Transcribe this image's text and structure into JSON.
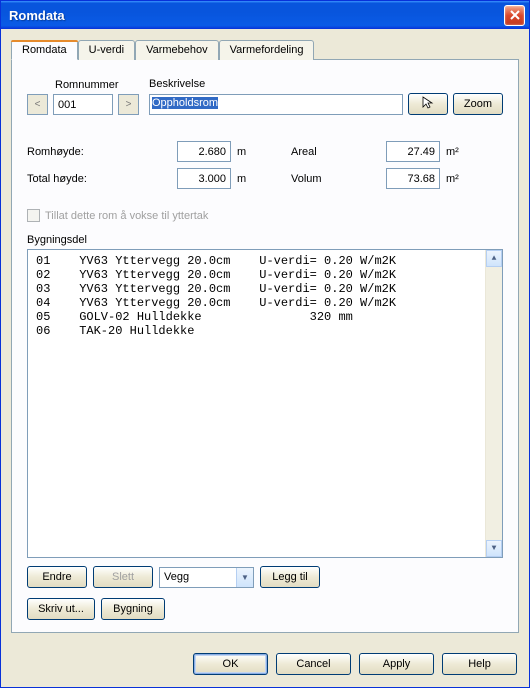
{
  "title": "Romdata",
  "tabs": [
    {
      "label": "Romdata",
      "active": true
    },
    {
      "label": "U-verdi",
      "active": false
    },
    {
      "label": "Varmebehov",
      "active": false
    },
    {
      "label": "Varmefordeling",
      "active": false
    }
  ],
  "header": {
    "romnummer_label": "Romnummer",
    "romnummer_value": "001",
    "beskrivelse_label": "Beskrivelse",
    "beskrivelse_value": "Oppholdsrom",
    "zoom_label": "Zoom"
  },
  "dims": {
    "romhoyde_label": "Romhøyde:",
    "romhoyde_value": "2.680",
    "romhoyde_unit": "m",
    "totalhoyde_label": "Total høyde:",
    "totalhoyde_value": "3.000",
    "totalhoyde_unit": "m",
    "areal_label": "Areal",
    "areal_value": "27.49",
    "areal_unit": "m²",
    "volum_label": "Volum",
    "volum_value": "73.68",
    "volum_unit": "m²"
  },
  "allow_grow_label": "Tillat dette rom å vokse til yttertak",
  "bygningsdel_label": "Bygningsdel",
  "list": [
    "01    YV63 Yttervegg 20.0cm    U-verdi= 0.20 W/m2K",
    "02    YV63 Yttervegg 20.0cm    U-verdi= 0.20 W/m2K",
    "03    YV63 Yttervegg 20.0cm    U-verdi= 0.20 W/m2K",
    "04    YV63 Yttervegg 20.0cm    U-verdi= 0.20 W/m2K",
    "05    GOLV-02 Hulldekke               320 mm",
    "06    TAK-20 Hulldekke"
  ],
  "controls": {
    "endre": "Endre",
    "slett": "Slett",
    "type_value": "Vegg",
    "leggtil": "Legg til",
    "skrivut": "Skriv ut...",
    "bygning": "Bygning"
  },
  "dlg": {
    "ok": "OK",
    "cancel": "Cancel",
    "apply": "Apply",
    "help": "Help"
  }
}
